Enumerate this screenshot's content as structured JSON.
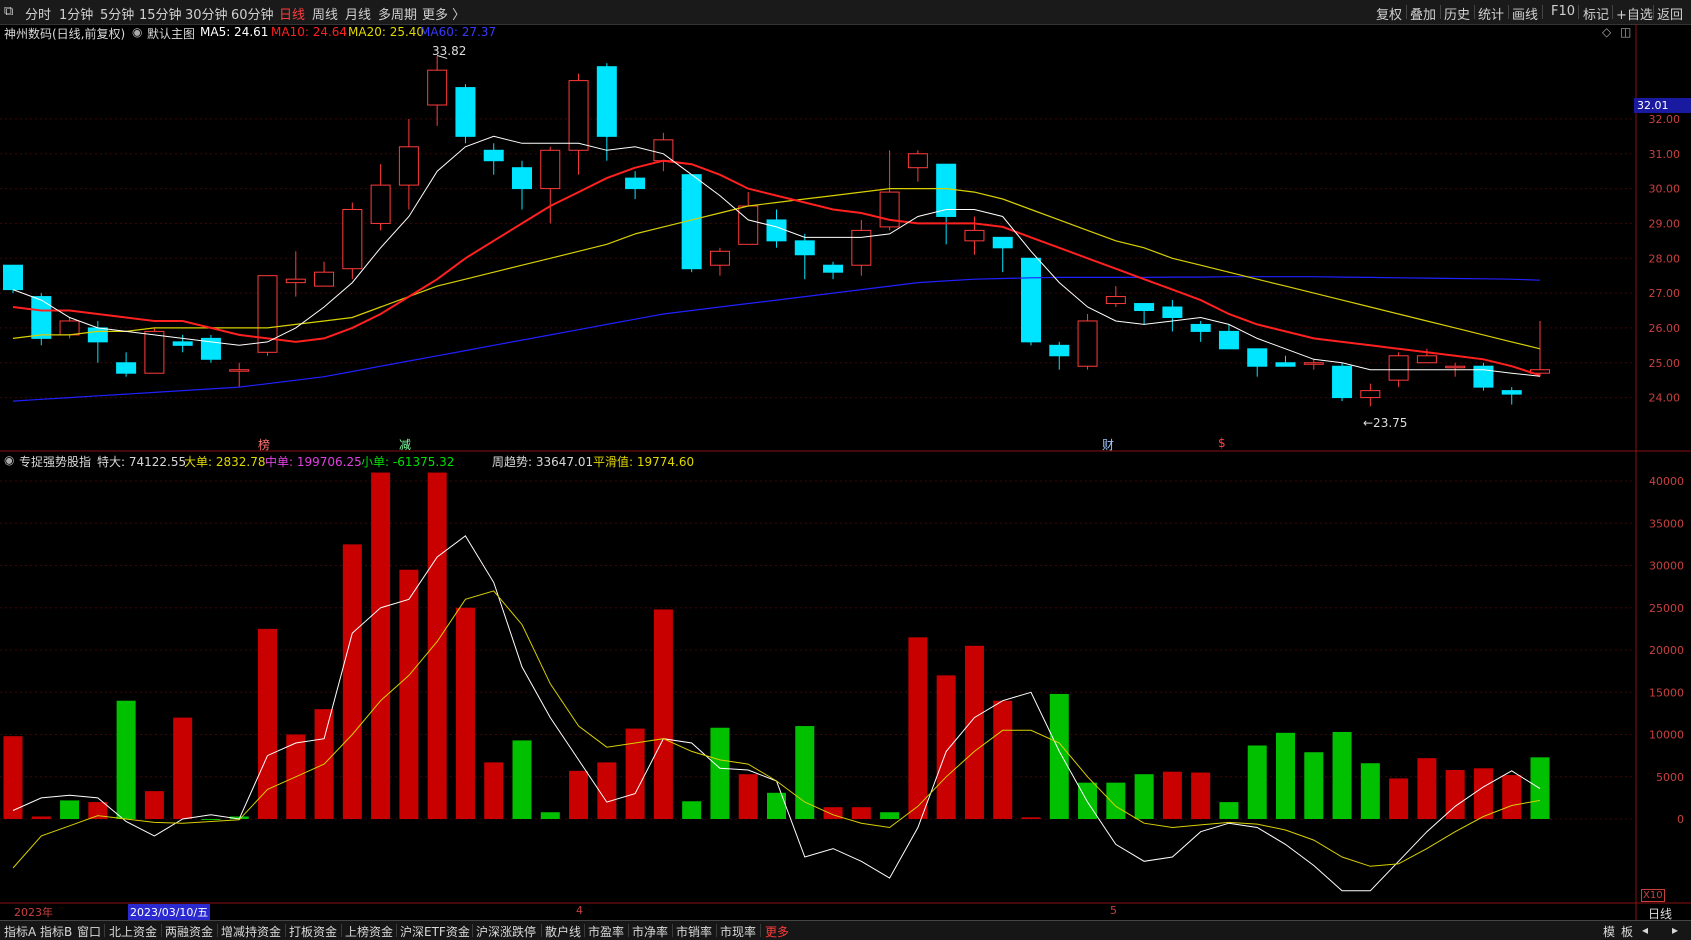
{
  "toolbar": {
    "left_items": [
      "分时",
      "1分钟",
      "5分钟",
      "15分钟",
      "30分钟",
      "60分钟",
      "日线",
      "周线",
      "月线",
      "多周期",
      "更多 〉"
    ],
    "active_item": "日线",
    "right_items": [
      "复权",
      "叠加",
      "历史",
      "统计",
      "画线",
      "F10",
      "标记",
      "+自选",
      "返回"
    ]
  },
  "main_info": {
    "stock": "神州数码(日线,前复权)",
    "template": "默认主图",
    "ma5": "MA5: 24.61",
    "ma10": "MA10: 24.64",
    "ma20": "MA20: 25.40",
    "ma60": "MA60: 27.37"
  },
  "sub_info": {
    "indicator": "专捉强势股指",
    "tedа": "特大: 74122.55",
    "dadan": "大单: 2832.78",
    "zhongdan": "中单: 199706.25",
    "xiaodan": "小单: -61375.32",
    "zhouqushi": "周趋势: 33647.01",
    "pinghua": "平滑值: 19774.60"
  },
  "colors": {
    "up": "#ff3b3b",
    "down": "#00e5ff",
    "ma5": "#ffffff",
    "ma10": "#ff2020",
    "ma20": "#d8d000",
    "ma60": "#2020ff",
    "bar_red": "#c80000",
    "bar_green": "#00c000",
    "axis_text": "#c8403e"
  },
  "markers": {
    "high": "33.82",
    "low": "←23.75",
    "price_tag": "32.01",
    "event_tags": [
      "榜",
      "减",
      "财",
      "$"
    ]
  },
  "bottom_axis": {
    "year": "2023年",
    "cursor_date": "2023/03/10/五",
    "month_4": "4",
    "month_5": "5",
    "x10": "X10",
    "period": "日线"
  },
  "bottom_bar": {
    "items": [
      "指标A",
      "指标B",
      "窗口",
      "北上资金",
      "两融资金",
      "增减持资金",
      "打板资金",
      "上榜资金",
      "沪深ETF资金",
      "沪深涨跌停",
      "散户线",
      "市盈率",
      "市净率",
      "市销率",
      "市现率",
      "更多"
    ],
    "right_items": [
      "模",
      "板"
    ]
  },
  "chart_data": {
    "type": "candlestick",
    "price_axis": [
      "32.00",
      "31.00",
      "30.00",
      "29.00",
      "28.00",
      "27.00",
      "26.00",
      "25.00",
      "24.00"
    ],
    "volume_axis": [
      "40000",
      "35000",
      "30000",
      "25000",
      "20000",
      "15000",
      "10000",
      "5000",
      "0"
    ],
    "candles": [
      [
        27.8,
        27.1,
        27.8,
        27.0
      ],
      [
        26.9,
        25.7,
        27.0,
        25.5
      ],
      [
        25.8,
        26.2,
        26.3,
        25.7
      ],
      [
        26.0,
        25.6,
        26.2,
        25.0
      ],
      [
        25.0,
        24.7,
        25.3,
        24.6
      ],
      [
        24.7,
        25.9,
        26.0,
        24.7
      ],
      [
        25.6,
        25.5,
        25.8,
        25.3
      ],
      [
        25.7,
        25.1,
        25.8,
        25.0
      ],
      [
        24.8,
        24.8,
        25.0,
        24.3
      ],
      [
        25.3,
        27.5,
        27.5,
        25.2
      ],
      [
        27.3,
        27.4,
        28.2,
        26.9
      ],
      [
        27.2,
        27.6,
        27.9,
        27.2
      ],
      [
        27.7,
        29.4,
        29.6,
        27.4
      ],
      [
        29.0,
        30.1,
        30.7,
        28.8
      ],
      [
        30.1,
        31.2,
        32.0,
        29.4
      ],
      [
        32.4,
        33.4,
        33.8,
        31.8
      ],
      [
        32.9,
        31.5,
        33.0,
        31.3
      ],
      [
        31.1,
        30.8,
        31.3,
        30.4
      ],
      [
        30.6,
        30.0,
        30.8,
        29.4
      ],
      [
        30.0,
        31.1,
        31.2,
        29.0
      ],
      [
        31.1,
        33.1,
        33.3,
        30.4
      ],
      [
        33.5,
        31.5,
        33.6,
        30.8
      ],
      [
        30.3,
        30.0,
        30.5,
        29.7
      ],
      [
        30.8,
        31.4,
        31.6,
        30.5
      ],
      [
        30.4,
        27.7,
        30.4,
        27.6
      ],
      [
        27.8,
        28.2,
        28.3,
        27.5
      ],
      [
        28.4,
        29.5,
        29.9,
        28.4
      ],
      [
        29.1,
        28.5,
        29.4,
        28.3
      ],
      [
        28.5,
        28.1,
        28.7,
        27.4
      ],
      [
        27.8,
        27.6,
        27.9,
        27.4
      ],
      [
        27.8,
        28.8,
        29.1,
        27.5
      ],
      [
        28.9,
        29.9,
        31.1,
        28.8
      ],
      [
        30.6,
        31.0,
        31.1,
        30.2
      ],
      [
        30.7,
        29.2,
        30.7,
        28.4
      ],
      [
        28.5,
        28.8,
        29.2,
        28.1
      ],
      [
        28.6,
        28.3,
        28.6,
        27.6
      ],
      [
        28.0,
        25.6,
        28.0,
        25.5
      ],
      [
        25.5,
        25.2,
        25.6,
        24.8
      ],
      [
        24.9,
        26.2,
        26.4,
        24.8
      ],
      [
        26.7,
        26.9,
        27.2,
        26.6
      ],
      [
        26.7,
        26.5,
        26.7,
        26.1
      ],
      [
        26.6,
        26.3,
        26.8,
        25.9
      ],
      [
        26.1,
        25.9,
        26.2,
        25.6
      ],
      [
        25.9,
        25.4,
        26.1,
        25.4
      ],
      [
        25.4,
        24.9,
        25.4,
        24.6
      ],
      [
        25.0,
        24.9,
        25.2,
        24.9
      ],
      [
        25.0,
        25.0,
        25.1,
        24.8
      ],
      [
        24.9,
        24.0,
        25.0,
        23.9
      ],
      [
        24.0,
        24.2,
        24.4,
        23.75
      ],
      [
        24.5,
        25.2,
        25.3,
        24.3
      ],
      [
        25.0,
        25.2,
        25.4,
        25.0
      ],
      [
        24.9,
        24.9,
        25.0,
        24.6
      ],
      [
        24.9,
        24.3,
        25.0,
        24.2
      ],
      [
        24.2,
        24.1,
        24.3,
        23.8
      ],
      [
        24.7,
        24.8,
        26.2,
        24.6
      ]
    ],
    "ma5": [
      27.1,
      26.8,
      26.3,
      26.0,
      25.9,
      25.8,
      25.7,
      25.6,
      25.5,
      25.6,
      26.0,
      26.6,
      27.3,
      28.3,
      29.2,
      30.5,
      31.2,
      31.5,
      31.3,
      31.3,
      31.3,
      31.1,
      31.2,
      31.0,
      30.4,
      29.8,
      29.1,
      28.9,
      28.6,
      28.6,
      28.6,
      28.7,
      29.2,
      29.4,
      29.4,
      29.2,
      28.2,
      27.3,
      26.6,
      26.2,
      26.1,
      26.2,
      26.3,
      26.1,
      25.7,
      25.4,
      25.1,
      25.0,
      24.8,
      24.8,
      24.8,
      24.8,
      24.8,
      24.7,
      24.61
    ],
    "ma10": [
      26.6,
      26.5,
      26.5,
      26.4,
      26.3,
      26.2,
      26.2,
      26.0,
      25.8,
      25.7,
      25.6,
      25.7,
      26.0,
      26.4,
      26.9,
      27.4,
      28.0,
      28.5,
      29.0,
      29.5,
      29.9,
      30.3,
      30.6,
      30.8,
      30.7,
      30.4,
      30.0,
      29.8,
      29.6,
      29.4,
      29.3,
      29.1,
      29.0,
      29.0,
      29.0,
      28.9,
      28.6,
      28.3,
      28.0,
      27.7,
      27.4,
      27.1,
      26.8,
      26.4,
      26.1,
      25.9,
      25.7,
      25.6,
      25.5,
      25.4,
      25.3,
      25.2,
      25.1,
      24.9,
      24.64
    ],
    "ma20": [
      25.7,
      25.8,
      25.8,
      25.9,
      25.9,
      26.0,
      26.0,
      26.0,
      26.0,
      26.0,
      26.1,
      26.2,
      26.3,
      26.6,
      26.9,
      27.2,
      27.4,
      27.6,
      27.8,
      28.0,
      28.2,
      28.4,
      28.7,
      28.9,
      29.1,
      29.3,
      29.5,
      29.6,
      29.7,
      29.8,
      29.9,
      30.0,
      30.0,
      30.0,
      29.9,
      29.7,
      29.4,
      29.1,
      28.8,
      28.5,
      28.3,
      28.0,
      27.8,
      27.6,
      27.4,
      27.2,
      27.0,
      26.8,
      26.6,
      26.4,
      26.2,
      26.0,
      25.8,
      25.6,
      25.4
    ],
    "ma60": [
      23.9,
      23.95,
      24.0,
      24.05,
      24.1,
      24.15,
      24.2,
      24.25,
      24.3,
      24.4,
      24.5,
      24.6,
      24.75,
      24.9,
      25.05,
      25.2,
      25.35,
      25.5,
      25.65,
      25.8,
      25.95,
      26.1,
      26.25,
      26.4,
      26.5,
      26.6,
      26.7,
      26.8,
      26.9,
      27.0,
      27.1,
      27.2,
      27.3,
      27.35,
      27.4,
      27.42,
      27.44,
      27.45,
      27.45,
      27.45,
      27.45,
      27.46,
      27.46,
      27.47,
      27.47,
      27.47,
      27.47,
      27.46,
      27.45,
      27.44,
      27.43,
      27.42,
      27.41,
      27.4,
      27.37
    ],
    "volume_bars": [
      9800,
      300,
      2200,
      2000,
      14000,
      3300,
      12000,
      -100,
      300,
      22500,
      10000,
      13000,
      32500,
      41000,
      29500,
      41000,
      25000,
      6700,
      9300,
      800,
      5700,
      6700,
      10700,
      24800,
      2100,
      10800,
      5300,
      3100,
      11000,
      1400,
      1400,
      800,
      21500,
      17000,
      20500,
      14000,
      200,
      14800,
      4300,
      4300,
      5300,
      5600,
      5500,
      2000,
      8700,
      10200,
      7900,
      10300,
      6600,
      4800,
      7200,
      5800,
      6000,
      5200,
      7300
    ],
    "volume_colors": [
      "r",
      "r",
      "g",
      "r",
      "g",
      "r",
      "r",
      "g",
      "g",
      "r",
      "r",
      "r",
      "r",
      "r",
      "r",
      "r",
      "r",
      "r",
      "g",
      "g",
      "r",
      "r",
      "r",
      "r",
      "g",
      "g",
      "r",
      "g",
      "g",
      "r",
      "r",
      "g",
      "r",
      "r",
      "r",
      "r",
      "r",
      "g",
      "g",
      "g",
      "g",
      "r",
      "r",
      "g",
      "g",
      "g",
      "g",
      "g",
      "g",
      "r",
      "r",
      "r",
      "r",
      "r",
      "g"
    ],
    "white_line": [
      1000,
      2500,
      2800,
      2500,
      -300,
      -2000,
      0,
      500,
      0,
      7500,
      9000,
      9500,
      22000,
      25000,
      26000,
      31000,
      33500,
      28000,
      18000,
      12000,
      7000,
      2000,
      3000,
      9500,
      9000,
      6000,
      5800,
      4500,
      -4500,
      -3500,
      -5000,
      -7000,
      -1000,
      8000,
      12000,
      14000,
      15000,
      8000,
      2000,
      -3000,
      -5000,
      -4500,
      -1500,
      -500,
      -1000,
      -3000,
      -5500,
      -8500,
      -8500,
      -5000,
      -1500,
      1500,
      3800,
      5700,
      3600
    ],
    "yellow_line": [
      -5800,
      -2000,
      -800,
      400,
      0,
      -400,
      -500,
      -300,
      -100,
      3500,
      5000,
      6500,
      10000,
      14000,
      17000,
      21000,
      26000,
      27000,
      23000,
      16000,
      11000,
      8500,
      9000,
      9500,
      8000,
      7000,
      6500,
      4500,
      2000,
      500,
      -500,
      -1000,
      1500,
      5000,
      8000,
      10500,
      10500,
      9000,
      5000,
      1500,
      -500,
      -1000,
      -700,
      -400,
      -600,
      -1300,
      -2500,
      -4500,
      -5600,
      -5300,
      -3500,
      -1500,
      300,
      1600,
      2200
    ]
  }
}
